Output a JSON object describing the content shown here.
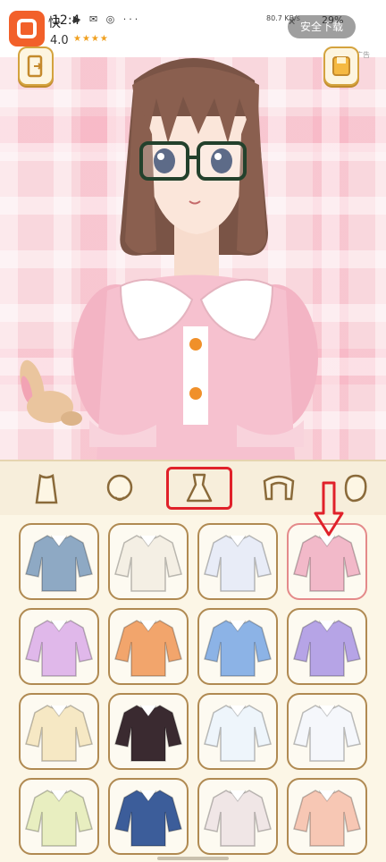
{
  "ad_banner": {
    "app_title": "快",
    "time": "12:4",
    "rating": "4.0",
    "stars": "★★★★",
    "speed": "80.7 KB/s",
    "download_label": "安全下载",
    "battery": "29%",
    "ad_tag": "广告"
  },
  "toolbar": {
    "exit_icon": "door-exit-icon",
    "save_icon": "save-icon"
  },
  "category_tabs": [
    {
      "id": "body",
      "icon": "body-icon",
      "active": false
    },
    {
      "id": "face",
      "icon": "face-icon",
      "active": false
    },
    {
      "id": "top",
      "icon": "dress-icon",
      "active": true
    },
    {
      "id": "hair",
      "icon": "hair-icon",
      "active": false
    },
    {
      "id": "head",
      "icon": "head-icon",
      "active": false
    }
  ],
  "clothing_items": [
    {
      "name": "blue-kimono-top",
      "color": "#8ea9c4",
      "selected": false
    },
    {
      "name": "white-ribbon-top",
      "color": "#f4efe4",
      "selected": false
    },
    {
      "name": "sailor-bow-top",
      "color": "#e8ecf7",
      "selected": false
    },
    {
      "name": "pink-puff-top",
      "color": "#f2b9c9",
      "selected": true
    },
    {
      "name": "lavender-suspender-top",
      "color": "#e0b8ea",
      "selected": false
    },
    {
      "name": "orange-pearl-crop",
      "color": "#f2a56c",
      "selected": false
    },
    {
      "name": "blue-lace-top",
      "color": "#8cb3e6",
      "selected": false
    },
    {
      "name": "purple-knit-sweater",
      "color": "#b6a4e6",
      "selected": false
    },
    {
      "name": "cream-lace-blouse",
      "color": "#f6e8c4",
      "selected": false
    },
    {
      "name": "black-red-gothic-top",
      "color": "#3a2a30",
      "selected": false
    },
    {
      "name": "white-maid-apron",
      "color": "#eef5fb",
      "selected": false
    },
    {
      "name": "white-sailor-shirt",
      "color": "#f5f7fb",
      "selected": false
    },
    {
      "name": "yellow-cardigan",
      "color": "#e8eec0",
      "selected": false
    },
    {
      "name": "navy-qipao-top",
      "color": "#3c5d9a",
      "selected": false
    },
    {
      "name": "black-white-maid-top",
      "color": "#f0e6e6",
      "selected": false
    },
    {
      "name": "peach-offshoulder-top",
      "color": "#f7c7b4",
      "selected": false
    }
  ]
}
